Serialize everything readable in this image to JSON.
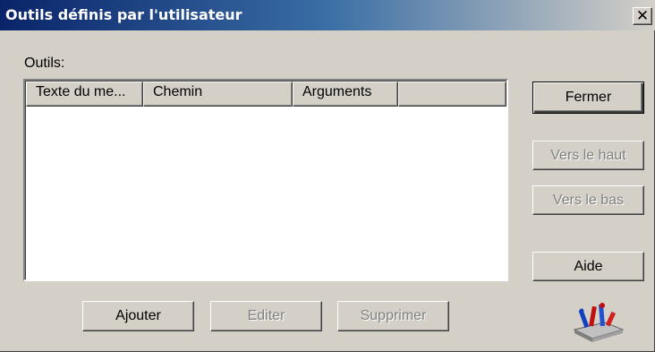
{
  "window": {
    "title": "Outils définis par l'utilisateur"
  },
  "tools_label": "Outils:",
  "list": {
    "columns": [
      "Texte du me...",
      "Chemin",
      "Arguments",
      ""
    ],
    "rows": []
  },
  "buttons": {
    "close": "Fermer",
    "up": "Vers le haut",
    "down": "Vers le bas",
    "help": "Aide",
    "add": "Ajouter",
    "edit": "Editer",
    "delete": "Supprimer"
  },
  "icons": {
    "close": "close-icon",
    "tools": "tools-icon"
  }
}
